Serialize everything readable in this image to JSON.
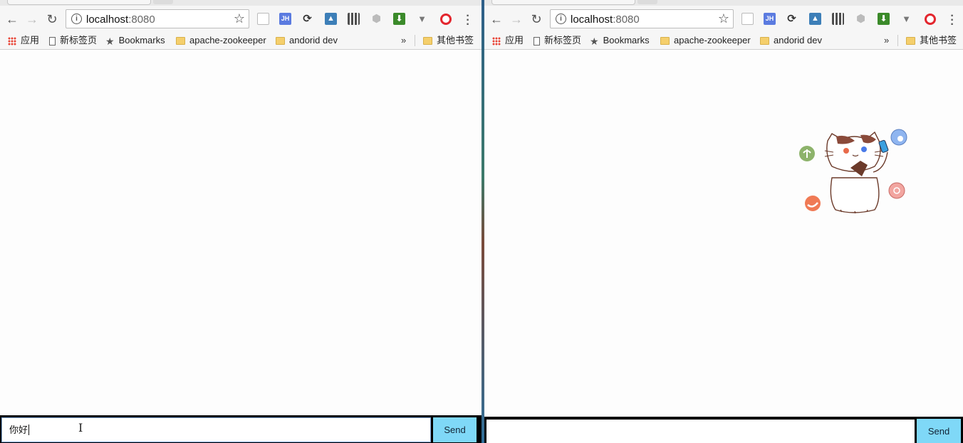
{
  "browser": {
    "url_host": "localhost",
    "url_port": ":8080",
    "bookmarks": {
      "apps": "应用",
      "new_tab": "新标签页",
      "bookmarks": "Bookmarks",
      "folder1": "apache-zookeeper",
      "folder2": "andorid dev",
      "overflow": "»",
      "other": "其他书签"
    },
    "extensions": [
      "reader-icon",
      "jh-icon",
      "sync-icon",
      "stack-icon",
      "qr-icon",
      "angular-icon",
      "download-icon",
      "vue-icon",
      "opera-icon"
    ],
    "ext_jh_label": "JH"
  },
  "left_window": {
    "chat_input_value": "你好",
    "send_label": "Send"
  },
  "right_window": {
    "chat_input_value": "",
    "send_label": "Send"
  },
  "colors": {
    "send_button": "#7fd8f7",
    "chat_bar": "#000000",
    "input_border": "#7ea6d8"
  }
}
